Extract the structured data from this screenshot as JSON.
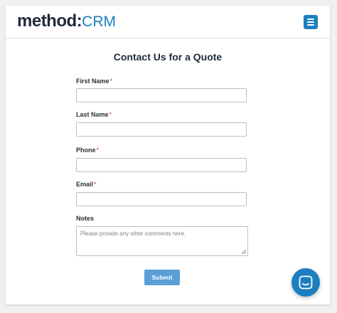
{
  "header": {
    "logo_method": "method",
    "logo_colon": ":",
    "logo_crm": "CRM",
    "menu_icon": "hamburger-menu-icon"
  },
  "form": {
    "title": "Contact Us for a Quote",
    "fields": [
      {
        "label": "First Name",
        "required_mark": "*",
        "value": ""
      },
      {
        "label": "Last Name",
        "required_mark": "*",
        "value": ""
      },
      {
        "label": "Phone",
        "required_mark": "*",
        "value": ""
      },
      {
        "label": "Email",
        "required_mark": "*",
        "value": ""
      }
    ],
    "notes": {
      "label": "Notes",
      "placeholder": "Please provide any other comments here."
    },
    "submit_label": "Submit"
  },
  "chat": {
    "icon": "chat-icon"
  },
  "colors": {
    "brand_blue": "#1b7fc0",
    "submit_blue": "#5b9fd6",
    "required_red": "#d0342c",
    "text_dark": "#1f2b3a"
  }
}
